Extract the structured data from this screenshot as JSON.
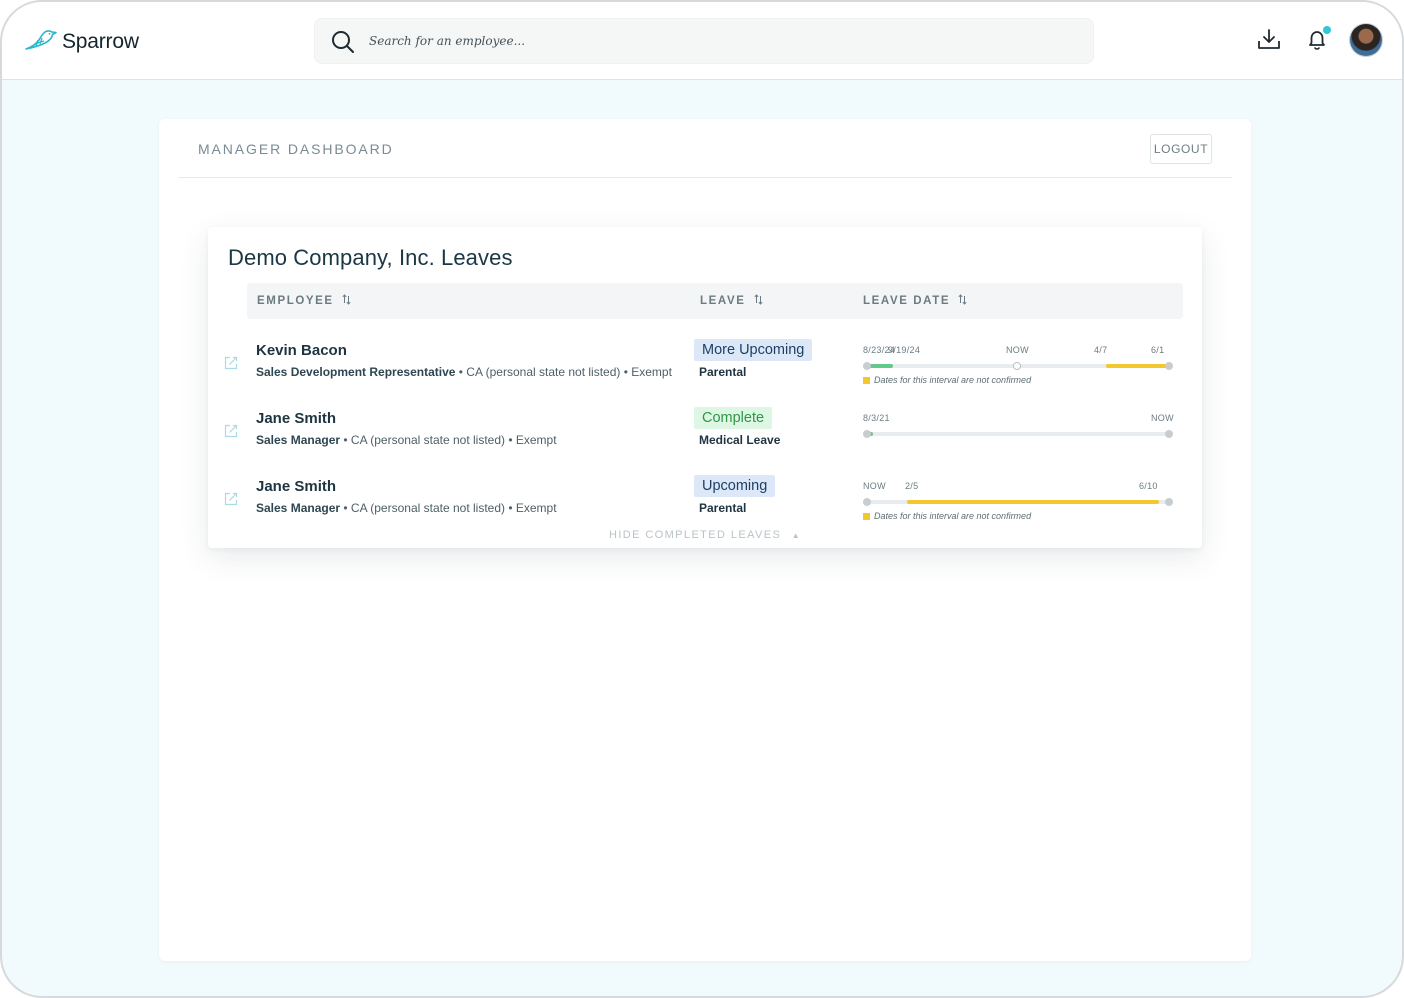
{
  "app": {
    "name": "Sparrow"
  },
  "search": {
    "placeholder": "Search for an employee..."
  },
  "panel": {
    "title": "MANAGER DASHBOARD",
    "logout_label": "LOGOUT"
  },
  "leaves": {
    "title": "Demo Company, Inc. Leaves",
    "columns": {
      "employee": "EMPLOYEE",
      "leave": "LEAVE",
      "leave_date": "LEAVE DATE"
    },
    "rows": [
      {
        "name": "Kevin Bacon",
        "title": "Sales Development Representative",
        "meta": " • CA (personal state not listed) • Exempt",
        "status": "More Upcoming",
        "leave_type": "Parental",
        "timeline_labels": [
          "8/23/24",
          "9/19/24",
          "NOW",
          "4/7",
          "6/1"
        ],
        "note": "Dates for this interval are not confirmed"
      },
      {
        "name": "Jane Smith",
        "title": "Sales Manager",
        "meta": " • CA (personal state not listed) • Exempt",
        "status": "Complete",
        "leave_type": "Medical Leave",
        "timeline_labels": [
          "8/3/21",
          "NOW"
        ]
      },
      {
        "name": "Jane Smith",
        "title": "Sales Manager",
        "meta": " • CA (personal state not listed) • Exempt",
        "status": "Upcoming",
        "leave_type": "Parental",
        "timeline_labels": [
          "NOW",
          "2/5",
          "6/10"
        ],
        "note": "Dates for this interval are not confirmed"
      }
    ],
    "hide_completed_label": "HIDE COMPLETED LEAVES"
  },
  "colors": {
    "accent": "#2ec8d8",
    "confirmed_segment": "#63c98a",
    "unconfirmed_segment": "#f3c82e",
    "upcoming_badge": "#dce8f8",
    "complete_badge": "#def7e4"
  },
  "icons": [
    "sparrow-logo-icon",
    "search-icon",
    "download-icon",
    "bell-icon",
    "sort-icon",
    "edit-icon",
    "caret-up-icon"
  ]
}
